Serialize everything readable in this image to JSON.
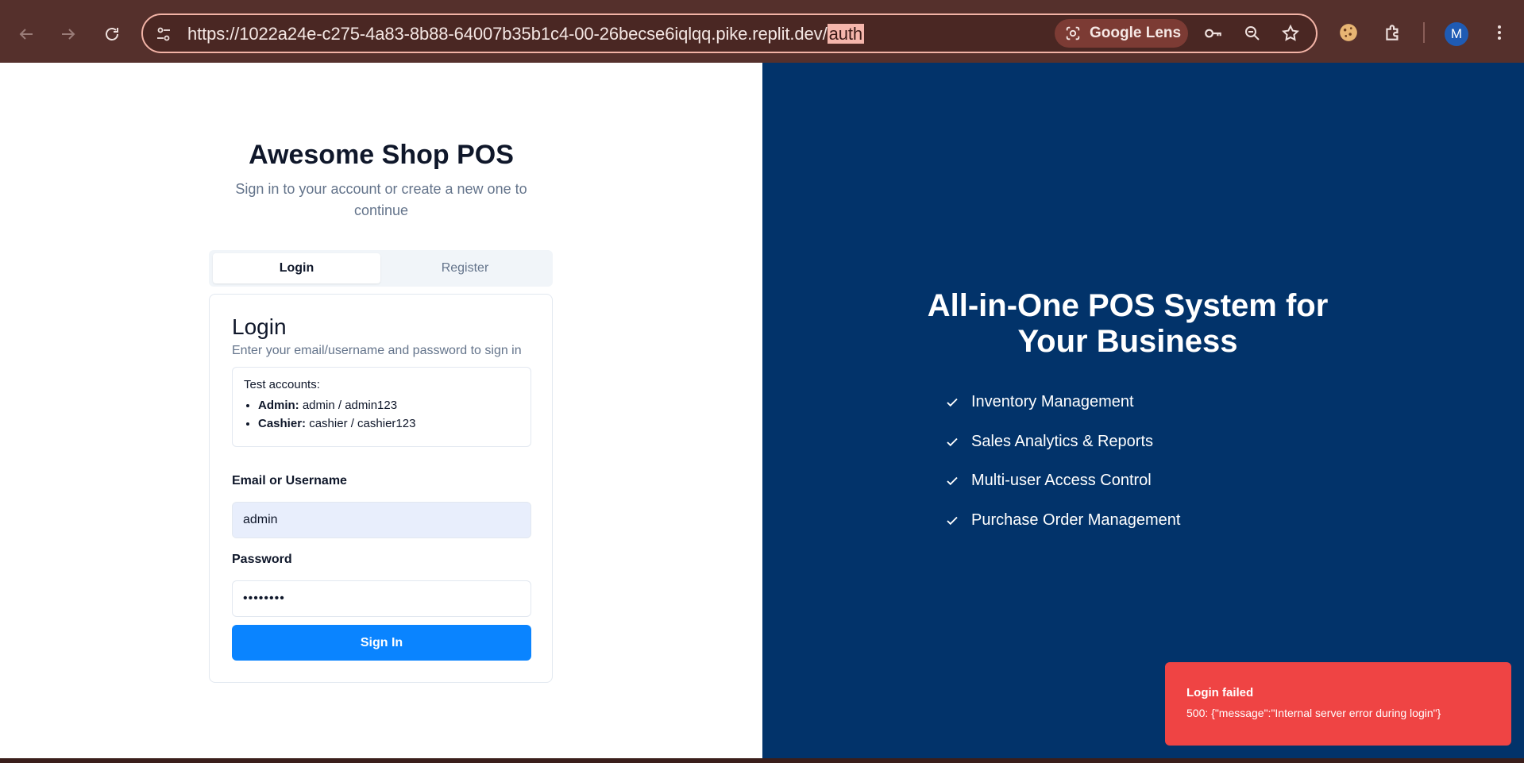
{
  "browser": {
    "url_prefix": "https://1022a24e-c275-4a83-8b88-64007b35b1c4-00-26becse6iqlqq.pike.replit.dev/",
    "url_highlight": "auth",
    "lens_label": "Google Lens",
    "profile_initial": "M",
    "icons": [
      "back-icon",
      "forward-icon",
      "reload-icon",
      "site-info-icon",
      "google-lens-icon",
      "password-key-icon",
      "zoom-icon",
      "bookmark-star-icon",
      "cookie-icon",
      "extensions-icon",
      "menu-icon"
    ]
  },
  "auth": {
    "title": "Awesome Shop POS",
    "subtitle": "Sign in to your account or create a new one to continue",
    "tabs": {
      "login": "Login",
      "register": "Register"
    },
    "card": {
      "title": "Login",
      "description": "Enter your email/username and password to sign in",
      "test_accounts": {
        "heading": "Test accounts:",
        "admin_role": "Admin:",
        "admin_creds": "admin / admin123",
        "cashier_role": "Cashier:",
        "cashier_creds": "cashier / cashier123"
      },
      "email_label": "Email or Username",
      "email_value": "admin",
      "password_label": "Password",
      "password_value": "••••••••",
      "submit_label": "Sign In"
    }
  },
  "hero": {
    "title": "All-in-One POS System for Your Business",
    "features": [
      "Inventory Management",
      "Sales Analytics & Reports",
      "Multi-user Access Control",
      "Purchase Order Management"
    ]
  },
  "toast": {
    "title": "Login failed",
    "message": "500: {\"message\":\"Internal server error during login\"}"
  },
  "colors": {
    "browser_bar": "#55302c",
    "hero_bg": "#02336a",
    "primary_button": "#0a84ff",
    "toast_bg": "#ef4444"
  }
}
